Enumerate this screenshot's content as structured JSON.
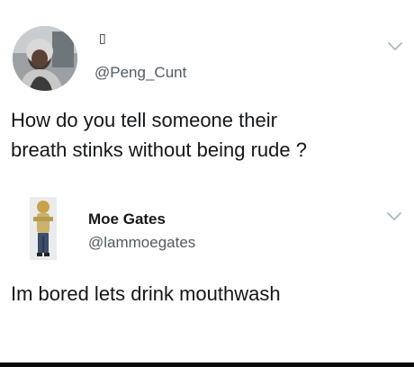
{
  "tweets": [
    {
      "display_name": "▯",
      "handle": "@Peng_Cunt",
      "text_lines": [
        "How do you tell someone their",
        "breath stinks without being rude ?"
      ]
    },
    {
      "display_name": "Moe Gates",
      "handle": "@lammoegates",
      "text_lines": [
        "Im bored lets drink mouthwash"
      ]
    }
  ],
  "icons": {
    "menu_chevron": "chevron-down-icon"
  },
  "colors": {
    "text": "#14171a",
    "secondary_text": "#515a63",
    "chevron": "#aab8c2"
  }
}
